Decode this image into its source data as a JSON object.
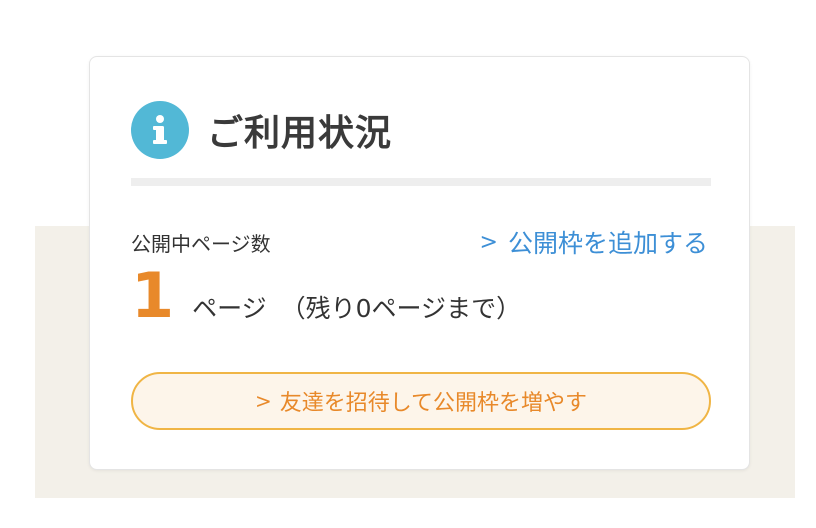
{
  "usage_card": {
    "title": "ご利用状況",
    "icon": "info-icon",
    "stat_label": "公開中ページ数",
    "add_link": {
      "chevron": ">",
      "label": "公開枠を追加する"
    },
    "count": {
      "value": "1",
      "unit": "ページ",
      "remaining": "（残り0ページまで）"
    },
    "invite_button": {
      "chevron": ">",
      "label": "友達を招待して公開枠を増やす"
    }
  },
  "colors": {
    "accent_orange": "#e8892a",
    "link_blue": "#3d8fd6",
    "info_icon_bg": "#52b8d6",
    "button_border": "#f0b545",
    "button_bg": "#fdf5ea",
    "background_panel": "#f3f0e9"
  }
}
